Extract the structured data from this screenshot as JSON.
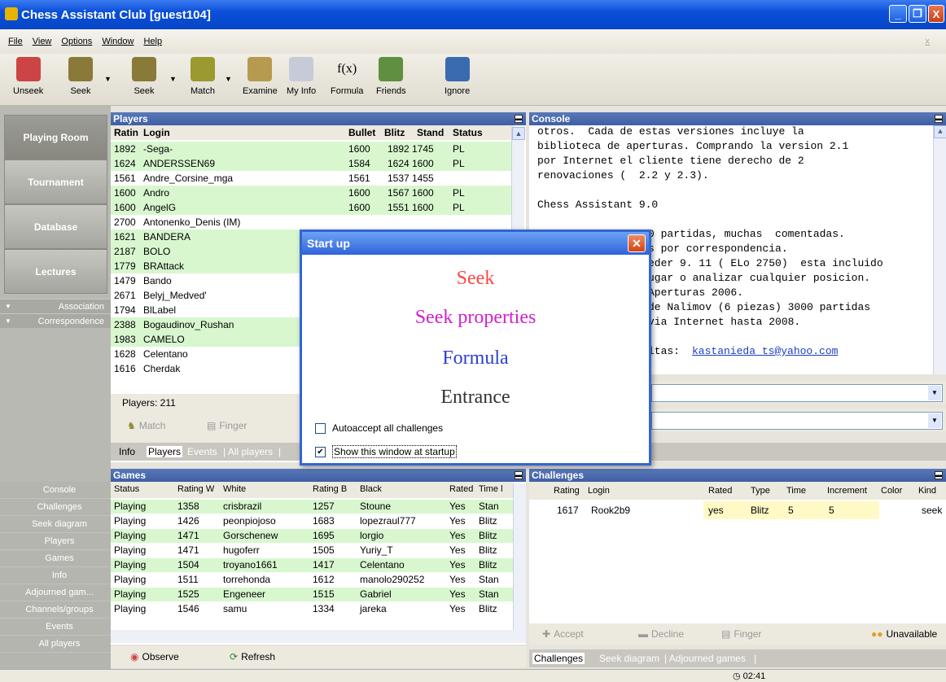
{
  "window": {
    "title": "Chess Assistant Club [guest104]",
    "min": "_",
    "max": "❐",
    "close": "X"
  },
  "menu": [
    "File",
    "View",
    "Options",
    "Window",
    "Help"
  ],
  "toolbar": {
    "unseek": "Unseek",
    "seek1": "Seek",
    "seek2": "Seek",
    "match": "Match",
    "examine": "Examine",
    "myinfo": "My Info",
    "formula": "Formula",
    "friends": "Friends",
    "ignore": "Ignore"
  },
  "nav": {
    "playing": "Playing Room",
    "tournament": "Tournament",
    "database": "Database",
    "lectures": "Lectures",
    "association": "Association",
    "correspondence": "Correspondence"
  },
  "bottomnav": [
    "Console",
    "Challenges",
    "Seek diagram",
    "Players",
    "Games",
    "Info",
    "Adjourned gam...",
    "Channels/groups",
    "Events",
    "All players"
  ],
  "players": {
    "title": "Players",
    "headers": {
      "rating": "Ratin",
      "login": "Login",
      "bullet": "Bullet",
      "blitz": "Blitz",
      "stand": "Stand",
      "status": "Status"
    },
    "rows": [
      {
        "r": "1892",
        "l": "-Sega-",
        "b": "1600",
        "bz": "1892",
        "s": "1745",
        "st": "PL",
        "g": true
      },
      {
        "r": "1624",
        "l": "ANDERSSEN69",
        "b": "1584",
        "bz": "1624",
        "s": "1600",
        "st": "PL",
        "g": true
      },
      {
        "r": "1561",
        "l": "Andre_Corsine_mga",
        "b": "1561",
        "bz": "1537",
        "s": "1455",
        "st": "",
        "g": false
      },
      {
        "r": "1600",
        "l": "Andro",
        "b": "1600",
        "bz": "1567",
        "s": "1600",
        "st": "PL",
        "g": true
      },
      {
        "r": "1600",
        "l": "AngelG",
        "b": "1600",
        "bz": "1551",
        "s": "1600",
        "st": "PL",
        "g": true
      },
      {
        "r": "2700",
        "l": "Antonenko_Denis (IM)",
        "b": "",
        "bz": "",
        "s": "",
        "st": "",
        "g": false
      },
      {
        "r": "1621",
        "l": "BANDERA",
        "b": "",
        "bz": "",
        "s": "",
        "st": "",
        "g": true
      },
      {
        "r": "2187",
        "l": "BOLO",
        "b": "",
        "bz": "",
        "s": "",
        "st": "",
        "g": true
      },
      {
        "r": "1779",
        "l": "BRAttack",
        "b": "",
        "bz": "",
        "s": "",
        "st": "",
        "g": true
      },
      {
        "r": "1479",
        "l": "Bando",
        "b": "",
        "bz": "",
        "s": "",
        "st": "",
        "g": false
      },
      {
        "r": "2671",
        "l": "Belyj_Medved'",
        "b": "",
        "bz": "",
        "s": "",
        "st": "",
        "g": false
      },
      {
        "r": "1794",
        "l": "BlLabel",
        "b": "",
        "bz": "",
        "s": "",
        "st": "",
        "g": false
      },
      {
        "r": "2388",
        "l": "Bogaudinov_Rushan",
        "b": "",
        "bz": "",
        "s": "",
        "st": "",
        "g": true
      },
      {
        "r": "1983",
        "l": "CAMELO",
        "b": "",
        "bz": "",
        "s": "",
        "st": "",
        "g": true
      },
      {
        "r": "1628",
        "l": "Celentano",
        "b": "",
        "bz": "",
        "s": "",
        "st": "",
        "g": false
      },
      {
        "r": "1616",
        "l": "Cherdak",
        "b": "",
        "bz": "",
        "s": "",
        "st": "",
        "g": false
      }
    ],
    "count": "Players: 211",
    "match": "Match",
    "finger": "Finger"
  },
  "playertabs": {
    "info": "Info",
    "players": "Players",
    "events": "Events",
    "all": "| All players",
    "sep": "|"
  },
  "console": {
    "title": "Console",
    "lines": [
      "otros.  Cada de estas versiones incluye la",
      "biblioteca de aperturas. Comprando la version 2.1",
      "por Internet el cliente tiene derecho de 2",
      "renovaciones (  2.2 y 2.3).",
      "",
      "Chess Assistant 9.0",
      "",
      "0 partidas, muchas  comentadas.",
      "s por correspondencia.",
      "eder 9. 11 ( ELo 2750)  esta incluido",
      "ugar o analizar cualquier posicion.",
      "Aperturas 2006.",
      "de Nalimov (6 piezas) 3000 partidas",
      "via Internet hasta 2008.",
      "",
      "ltas: "
    ],
    "email": "kastanieda ts@yahoo.com"
  },
  "games": {
    "title": "Games",
    "headers": [
      "Status",
      "Rating W",
      "White",
      "Rating B",
      "Black",
      "Rated",
      "Time l"
    ],
    "rows": [
      [
        "Playing",
        "1358",
        "crisbrazil",
        "1257",
        "Stoune",
        "Yes",
        "Stan"
      ],
      [
        "Playing",
        "1426",
        "peonpiojoso",
        "1683",
        "lopezraul777",
        "Yes",
        "Blitz"
      ],
      [
        "Playing",
        "1471",
        "Gorschenew",
        "1695",
        "lorgio",
        "Yes",
        "Blitz"
      ],
      [
        "Playing",
        "1471",
        "hugoferr",
        "1505",
        "Yuriy_T",
        "Yes",
        "Blitz"
      ],
      [
        "Playing",
        "1504",
        "troyano1661",
        "1417",
        "Celentano",
        "Yes",
        "Blitz"
      ],
      [
        "Playing",
        "1511",
        "torrehonda",
        "1612",
        "manolo290252",
        "Yes",
        "Stan"
      ],
      [
        "Playing",
        "1525",
        "Engeneer",
        "1515",
        "Gabriel",
        "Yes",
        "Stan"
      ],
      [
        "Playing",
        "1546",
        "samu",
        "1334",
        "jareka",
        "Yes",
        "Blitz"
      ]
    ],
    "observe": "Observe",
    "refresh": "Refresh"
  },
  "challenges": {
    "title": "Challenges",
    "headers": [
      "Rating",
      "Login",
      "Rated",
      "Type",
      "Time",
      "Increment",
      "Color",
      "Kind"
    ],
    "row": [
      "1617",
      "Rook2b9",
      "yes",
      "Blitz",
      "5",
      "5",
      "",
      "seek"
    ],
    "accept": "Accept",
    "decline": "Decline",
    "finger": "Finger",
    "unavailable": "Unavailable",
    "tabs": {
      "challenges": "Challenges",
      "seekdiagram": "Seek diagram",
      "adjourned": "| Adjourned games",
      "sep": "|"
    }
  },
  "dialog": {
    "title": "Start up",
    "seek": "Seek",
    "seekprops": "Seek properties",
    "formula": "Formula",
    "entrance": "Entrance",
    "autoaccept": "Autoaccept all challenges",
    "showstartup": "Show this window at startup",
    "autoacceptChecked": false,
    "showChecked": true
  },
  "status": {
    "time": "02:41"
  },
  "colors": {
    "seek": "#ff4444",
    "seekprops": "#d020d0",
    "formula": "#2f3fcf",
    "entrance": "#333333",
    "rowgreen": "#d8f7cf",
    "titleblue": "#3e5fa3"
  }
}
